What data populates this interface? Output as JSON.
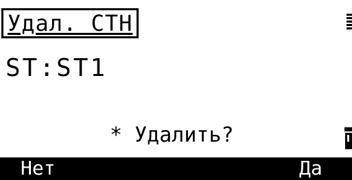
{
  "screen": {
    "title": "Удал. СТН",
    "station_line": "ST:ST1",
    "prompt": "* Удалить?"
  },
  "softkeys": {
    "f1_label": "Нет",
    "f4_label": "Да"
  },
  "colors": {
    "background": "#ffffff",
    "text": "#000000",
    "softkey_bar": "#000000",
    "softkey_text": "#ffffff"
  },
  "icons": {
    "top_right": "battery-icon",
    "bottom_right": "input-mode-icon"
  }
}
